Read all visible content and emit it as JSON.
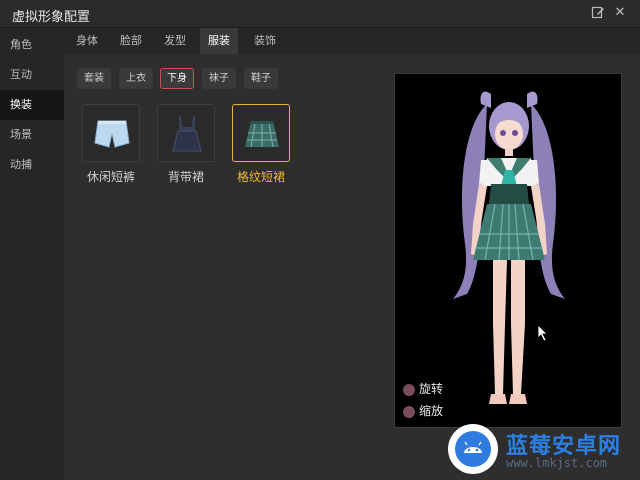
{
  "window": {
    "title": "虚拟形象配置",
    "edit_icon": "edit-icon",
    "close_icon": "close-icon",
    "close_glyph": "✕"
  },
  "sidebar": {
    "items": [
      {
        "label": "角色"
      },
      {
        "label": "互动"
      },
      {
        "label": "换装"
      },
      {
        "label": "场景"
      },
      {
        "label": "动捕"
      }
    ]
  },
  "tabs": [
    {
      "label": "身体"
    },
    {
      "label": "脸部"
    },
    {
      "label": "发型"
    },
    {
      "label": "服装"
    },
    {
      "label": "装饰"
    }
  ],
  "subtabs": [
    {
      "label": "套装"
    },
    {
      "label": "上衣"
    },
    {
      "label": "下身"
    },
    {
      "label": "袜子"
    },
    {
      "label": "鞋子"
    }
  ],
  "items": [
    {
      "label": "休闲短裤",
      "icon": "denim-shorts-icon"
    },
    {
      "label": "背带裙",
      "icon": "overall-skirt-icon"
    },
    {
      "label": "格纹短裙",
      "icon": "plaid-skirt-icon"
    }
  ],
  "preview": {
    "rotate_label": "旋转",
    "zoom_label": "缩放"
  },
  "watermark": {
    "title": "蓝莓安卓网",
    "url": "www.lmkjst.com"
  },
  "colors": {
    "accent_selected": "#f0b928",
    "subtab_selected_border": "#d24b5a",
    "watermark_blue": "#2d7fe4"
  }
}
